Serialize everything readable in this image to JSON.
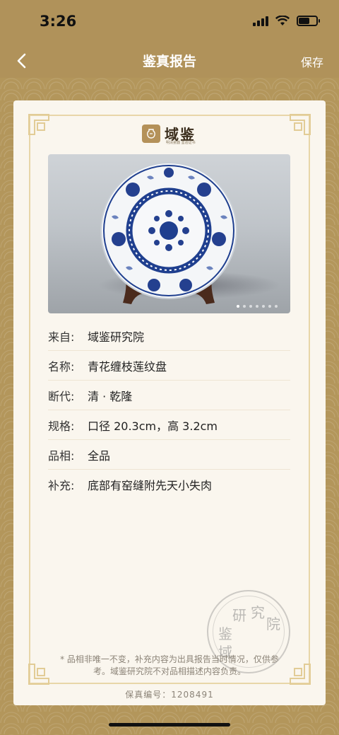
{
  "status": {
    "time": "3:26"
  },
  "nav": {
    "title": "鉴真报告",
    "action": "保存"
  },
  "logo": {
    "text": "域鉴",
    "sub": "明清瓷器 鉴验证书"
  },
  "photo": {
    "slide_count": 7,
    "active_index": 0
  },
  "info": [
    {
      "key": "来自:",
      "value": "域鉴研究院"
    },
    {
      "key": "名称:",
      "value": "青花缠枝莲纹盘"
    },
    {
      "key": "断代:",
      "value": "清 · 乾隆"
    },
    {
      "key": "规格:",
      "value": "口径 20.3cm，高 3.2cm"
    },
    {
      "key": "品相:",
      "value": "全品"
    },
    {
      "key": "补充:",
      "value": "底部有窑缝附先天小失肉"
    }
  ],
  "seal": {
    "chars": [
      "研",
      "究",
      "院",
      "鉴",
      "域"
    ]
  },
  "disclaimer": "* 品相非唯一不变，补充内容为出具报告当时情况，仅供参考。域鉴研究院不对品相描述内容负责。",
  "serial": {
    "label": "保真编号：",
    "value": "1208491"
  },
  "colors": {
    "gold": "#b3965b",
    "card": "#faf6ee",
    "porcelain_blue": "#1f3f8f"
  }
}
